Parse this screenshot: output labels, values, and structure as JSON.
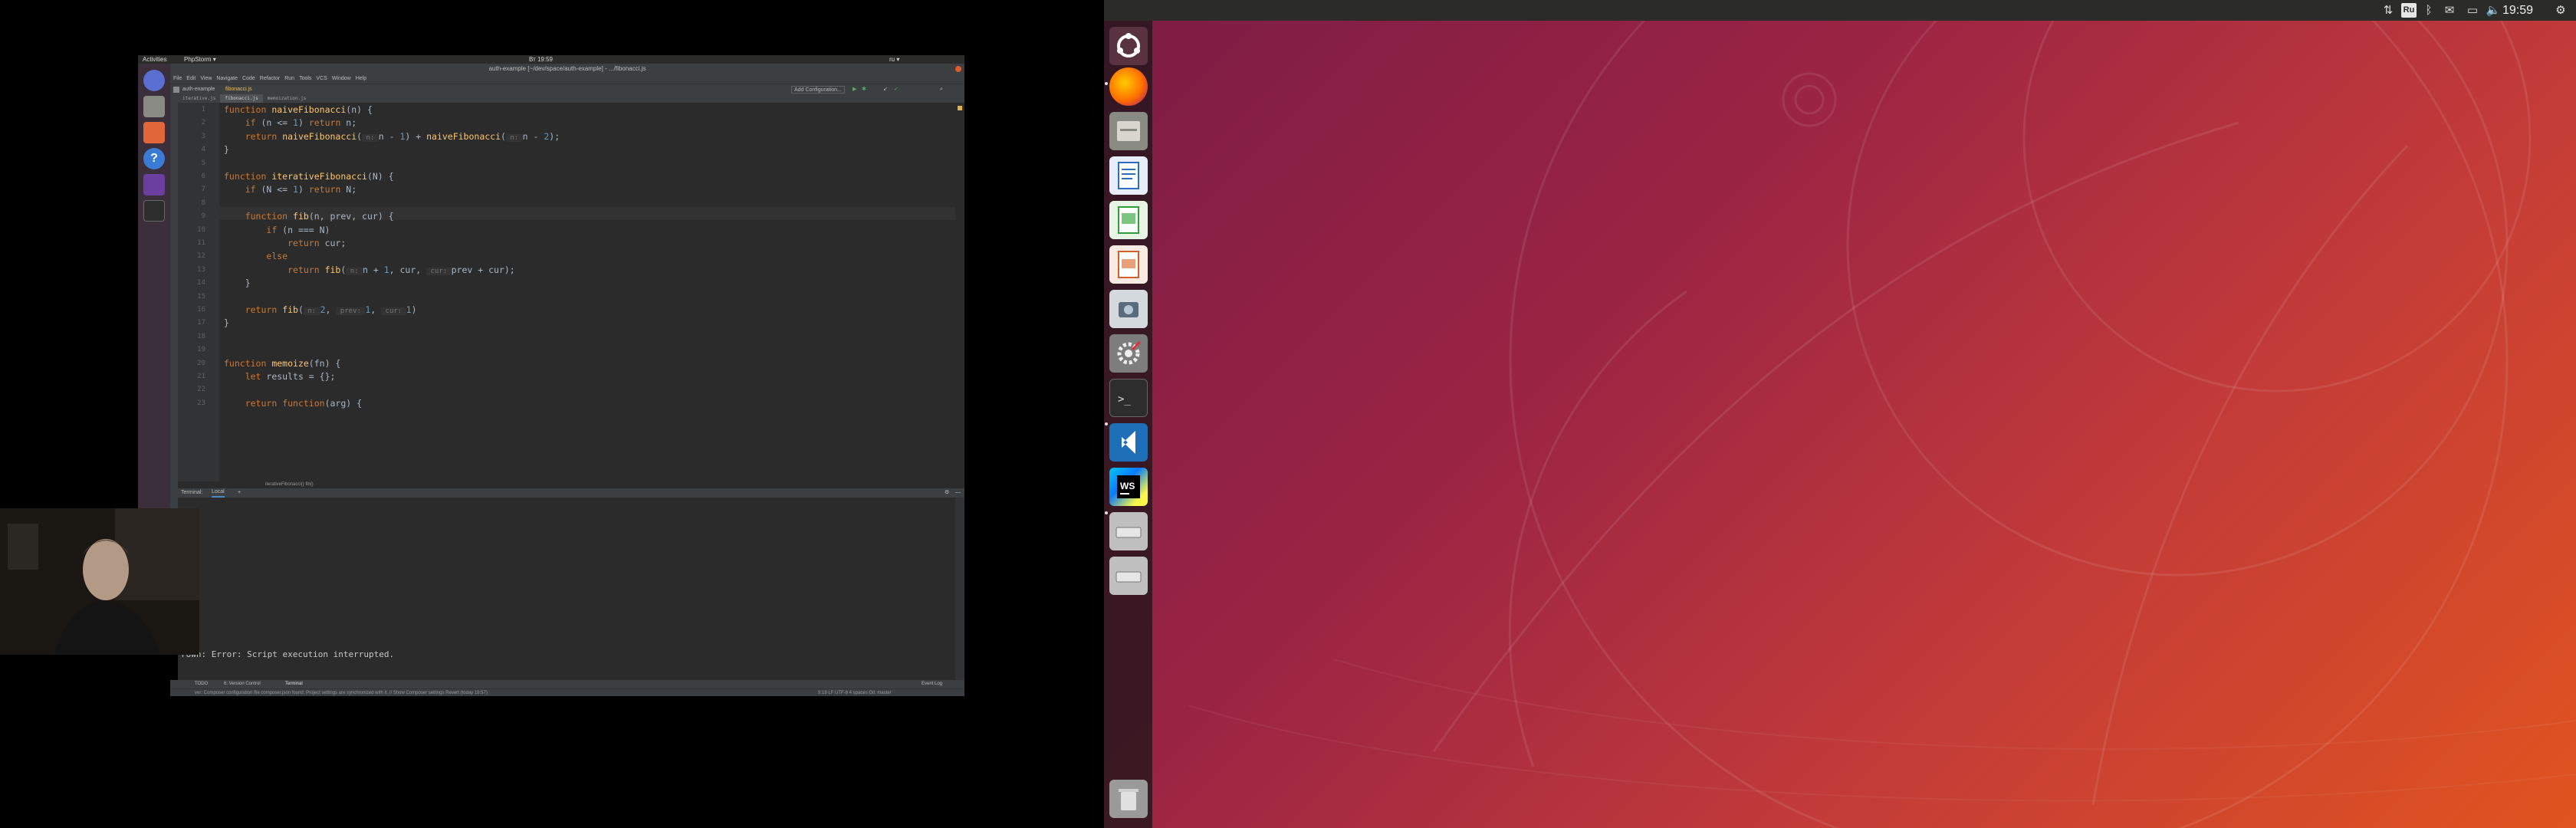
{
  "right_desktop": {
    "clock": "19:59",
    "keyboard_layout": "Ru",
    "launcher_items": [
      {
        "name": "ubuntu-logo"
      },
      {
        "name": "firefox"
      },
      {
        "name": "files"
      },
      {
        "name": "libreoffice-writer"
      },
      {
        "name": "libreoffice-calc"
      },
      {
        "name": "libreoffice-impress"
      },
      {
        "name": "screenshot-tool"
      },
      {
        "name": "system-settings"
      },
      {
        "name": "terminal"
      },
      {
        "name": "vscode"
      },
      {
        "name": "webstorm"
      },
      {
        "name": "drive-1"
      },
      {
        "name": "drive-2"
      },
      {
        "name": "trash"
      }
    ],
    "colors": {
      "wallpaper_start": "#7c1c45",
      "wallpaper_end": "#e0541f",
      "panel": "#2b2b29"
    }
  },
  "left_topbar": {
    "activities": "Activities",
    "app_menu": "PhpStorm ▾",
    "clock": "Вт 19:59",
    "layout": "ru ▾"
  },
  "ide": {
    "title": "auth-example [~/dev/space/auth-example] - .../fibonacci.js",
    "menu": [
      "File",
      "Edit",
      "View",
      "Navigate",
      "Code",
      "Refactor",
      "Run",
      "Tools",
      "VCS",
      "Window",
      "Help"
    ],
    "project_breadcrumb": "auth-example",
    "file_breadcrumb": "fibonacci.js",
    "add_configuration": "Add Configuration...",
    "tabs": [
      {
        "label": "iterative.js",
        "active": false
      },
      {
        "label": "fibonacci.js",
        "active": true
      },
      {
        "label": "memoization.js",
        "active": false
      }
    ],
    "code_lines": [
      {
        "n": "1",
        "html": "<span class='kw'>function</span> <span class='fn'>naiveFibonacci</span>(n) {"
      },
      {
        "n": "2",
        "html": "    <span class='kw'>if</span> (n <= <span class='num'>1</span>) <span class='kw'>return</span> n;"
      },
      {
        "n": "3",
        "html": "    <span class='kw'>return</span> <span class='fn'>naiveFibonacci</span>(<span class='hint'> n: </span>n - <span class='num'>1</span>) + <span class='fn'>naiveFibonacci</span>(<span class='hint'> n: </span>n - <span class='num'>2</span>);"
      },
      {
        "n": "4",
        "html": "}"
      },
      {
        "n": "5",
        "html": ""
      },
      {
        "n": "6",
        "html": "<span class='kw'>function</span> <span class='fn'>iterativeFibonacci</span>(N) {"
      },
      {
        "n": "7",
        "html": "    <span class='kw'>if</span> (N <= <span class='num'>1</span>) <span class='kw'>return</span> N;"
      },
      {
        "n": "8",
        "html": ""
      },
      {
        "n": "9",
        "html": "    <span class='kw'>function</span> <span class='fn'>fib</span>(n, prev, cur) {"
      },
      {
        "n": "10",
        "html": "        <span class='kw'>if</span> (n === N)"
      },
      {
        "n": "11",
        "html": "            <span class='kw'>return</span> cur;"
      },
      {
        "n": "12",
        "html": "        <span class='kw'>else</span>"
      },
      {
        "n": "13",
        "html": "            <span class='kw'>return</span> <span class='fn'>fib</span>(<span class='hint'> n: </span>n + <span class='num'>1</span>, cur, <span class='hint'> cur: </span>prev + cur);"
      },
      {
        "n": "14",
        "html": "    }"
      },
      {
        "n": "15",
        "html": ""
      },
      {
        "n": "16",
        "html": "    <span class='kw'>return</span> <span class='fn'>fib</span>(<span class='hint'> n: </span><span class='num'>2</span>, <span class='hint'> prev: </span><span class='num'>1</span>, <span class='hint'> cur: </span><span class='num'>1</span>)"
      },
      {
        "n": "17",
        "html": "}"
      },
      {
        "n": "18",
        "html": ""
      },
      {
        "n": "19",
        "html": ""
      },
      {
        "n": "20",
        "html": "<span class='kw'>function</span> <span class='fn'>memoize</span>(fn) {"
      },
      {
        "n": "21",
        "html": "    <span class='kw'>let</span> results = {};"
      },
      {
        "n": "22",
        "html": ""
      },
      {
        "n": "23",
        "html": "    <span class='kw'>return</span> <span class='kw'>function</span>(arg) {"
      }
    ],
    "editor_breadcrumb": "iterativeFibonacci()   fib()",
    "terminal_tabs": [
      "Terminal:",
      "Local",
      "+"
    ],
    "terminal_output": "rown: Error: Script execution interrupted.",
    "bottom_tools": [
      "TODO",
      "6: Version Control",
      "Terminal"
    ],
    "event_log": "Event Log",
    "status_message": "ver: Composer configuration file composer.json found: Project settings are synchronized with it. // Show Composer settings  Revert (today 19:57)",
    "status_right": "9:19   LF   UTF-8   4 spaces   Git: master"
  }
}
